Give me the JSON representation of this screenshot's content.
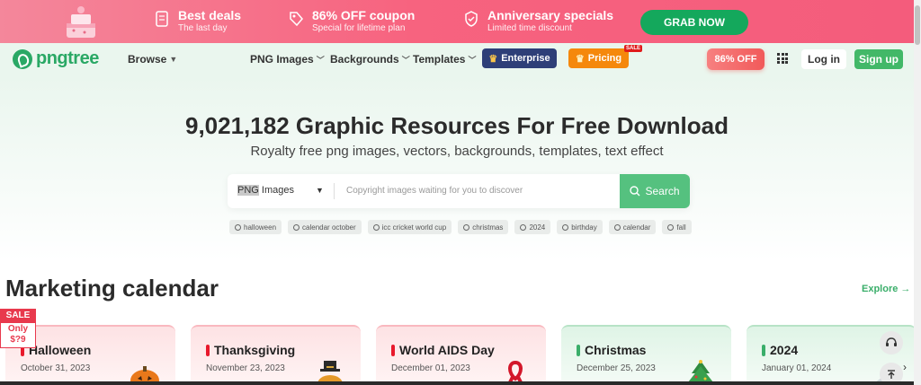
{
  "promo": {
    "deals": [
      {
        "title": "Best deals",
        "subtitle": "The last day",
        "icon": "ticket-icon"
      },
      {
        "title": "86% OFF coupon",
        "subtitle": "Special for lifetime plan",
        "icon": "tag-icon"
      },
      {
        "title": "Anniversary specials",
        "subtitle": "Limited time discount",
        "icon": "shield-check-icon"
      }
    ],
    "cta": "GRAB NOW"
  },
  "nav": {
    "logo": "pngtree",
    "browse": "Browse",
    "links": [
      "PNG Images",
      "Backgrounds",
      "Templates"
    ],
    "enterprise": "Enterprise",
    "pricing": "Pricing",
    "pricing_badge": "SALE",
    "off_button": "86% OFF",
    "login": "Log in",
    "signup": "Sign up"
  },
  "hero": {
    "title": "9,021,182 Graphic Resources For Free Download",
    "subtitle": "Royalty free png images, vectors, backgrounds, templates, text effect",
    "search": {
      "type_highlight": "PNG",
      "type_rest": " Images",
      "placeholder": "Copyright images waiting for you to discover",
      "button": "Search"
    },
    "tags": [
      "halloween",
      "calendar october",
      "icc cricket world cup",
      "christmas",
      "2024",
      "birthday",
      "calendar",
      "fall"
    ]
  },
  "calendar": {
    "title": "Marketing calendar",
    "explore": "Explore",
    "sale_badge": {
      "top": "SALE",
      "line1": "Only",
      "line2": "$?9"
    },
    "cards": [
      {
        "name": "Halloween",
        "date": "October 31, 2023",
        "theme": "red",
        "art": "pumpkin-icon"
      },
      {
        "name": "Thanksgiving",
        "date": "November 23, 2023",
        "theme": "red",
        "art": "turkey-icon"
      },
      {
        "name": "World AIDS Day",
        "date": "December 01, 2023",
        "theme": "red",
        "art": "ribbon-icon"
      },
      {
        "name": "Christmas",
        "date": "December 25, 2023",
        "theme": "green",
        "art": "tree-icon"
      },
      {
        "name": "2024",
        "date": "January 01, 2024",
        "theme": "green",
        "art": "newyear-icon"
      }
    ]
  },
  "colors": {
    "brand_green": "#2aa865",
    "promo_pink": "#f7637f",
    "grab_green": "#14a85c",
    "enterprise_navy": "#2e3f78",
    "pricing_orange": "#f5880c",
    "accent_red": "#e8192c"
  }
}
